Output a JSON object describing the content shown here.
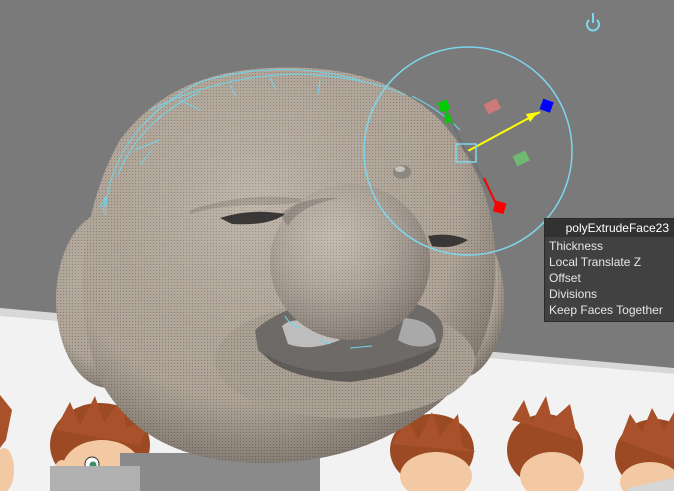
{
  "viewport": {
    "background_color": "#7a7a7a",
    "floor_color": "#f2f2f2",
    "mesh_color": "#b3a79a",
    "wireframe_color": "#6fd5ec"
  },
  "manipulator": {
    "x_axis_color": "#ff0000",
    "y_axis_color": "#00cc00",
    "z_axis_color": "#0000ff",
    "pointer_color": "#ffff00",
    "ring_color": "#7dd7ef",
    "pivot_icon": "pivot-power-icon"
  },
  "hud": {
    "title": "polyExtrudeFace23",
    "items": [
      {
        "label": "Thickness"
      },
      {
        "label": "Local Translate Z"
      },
      {
        "label": "Offset"
      },
      {
        "label": "Divisions"
      },
      {
        "label": "Keep Faces Together"
      }
    ]
  }
}
